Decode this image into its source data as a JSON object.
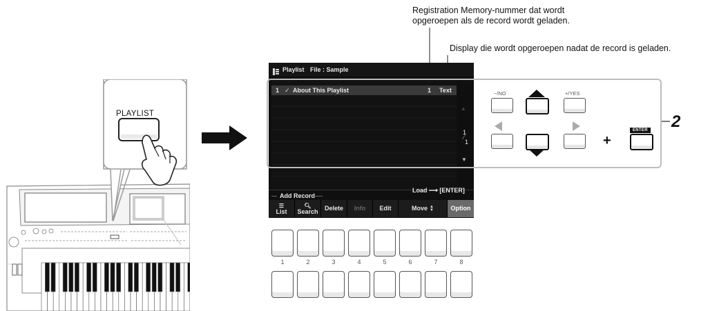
{
  "callouts": {
    "registration": "Registration Memory-nummer dat wordt opgeroepen als de record wordt geladen.",
    "registration_line1": "Registration Memory-nummer dat wordt",
    "registration_line2": "opgeroepen als de record wordt geladen.",
    "display": "Display die wordt opgeroepen nadat de record is geladen.",
    "step_number": "2"
  },
  "keyboard": {
    "playlist_button_label": "PLAYLIST"
  },
  "screen": {
    "title": "Playlist",
    "file_label": "File : Sample",
    "record": {
      "index": "1",
      "check": "✓",
      "name": "About This Playlist",
      "reg_number": "1",
      "display_type": "Text"
    },
    "page_current": "1",
    "page_separator": "⁄",
    "page_total": "1",
    "add_record": "Add Record",
    "load_hint": "Load ⟶ [ENTER]",
    "softkeys": [
      "List",
      "Search",
      "Delete",
      "Info",
      "Edit",
      "Move",
      "Option"
    ],
    "move_arrows": "▲▼"
  },
  "panel": {
    "numbers": [
      "1",
      "2",
      "3",
      "4",
      "5",
      "6",
      "7",
      "8"
    ],
    "no_label": "−/NO",
    "yes_label": "+/YES",
    "enter_label": "ENTER",
    "plus_sign": "+"
  },
  "colors": {
    "lcd_background": "#0f0f0f",
    "lcd_selected_row": "#3a3a3a",
    "option_key": "#6a6a6a",
    "frame_gray": "#bdbdbd"
  }
}
